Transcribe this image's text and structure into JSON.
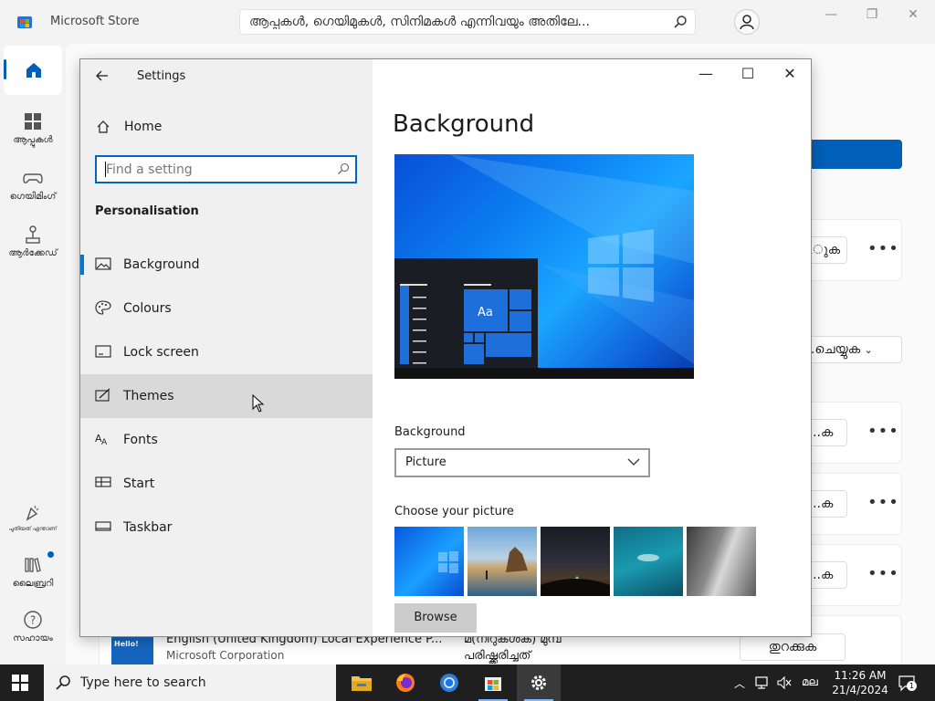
{
  "store": {
    "title": "Microsoft Store",
    "search_text": "ആപ്പുകൾ, ഗെയിമുകൾ, സിനിമകൾ എന്നിവയും അതിലേ...",
    "nav": [
      {
        "label": "ആപ്പുകൾ"
      },
      {
        "label": "ഗെയിമിംഗ്"
      },
      {
        "label": "ആർക്കേഡ്"
      },
      {
        "label": "പുതിയത് എന്താണ്"
      },
      {
        "label": "ലൈബ്രറി"
      },
      {
        "label": "സഹായം"
      }
    ],
    "rows": [
      {
        "button": "...ുക"
      },
      {
        "button": "...ചെയ്യുക"
      },
      {
        "button": "...ക"
      },
      {
        "button": "...ക"
      },
      {
        "button": "...ക"
      }
    ],
    "bottom_item": {
      "icon_text": "Hello!",
      "name": "English (United Kingdom) Local Experience P...",
      "publisher": "Microsoft Corporation",
      "status_line1": "മ(നിറുകൾക) മുമ്പ്",
      "status_line2": "പരിഷ്ക്കരിച്ചത്",
      "button": "തുറക്കുക"
    },
    "more_label": "•••"
  },
  "settings": {
    "title": "Settings",
    "home_label": "Home",
    "search_placeholder": "Find a setting",
    "section_title": "Personalisation",
    "nav": [
      {
        "label": "Background",
        "icon": "picture-icon"
      },
      {
        "label": "Colours",
        "icon": "palette-icon"
      },
      {
        "label": "Lock screen",
        "icon": "lock-screen-icon"
      },
      {
        "label": "Themes",
        "icon": "brush-icon"
      },
      {
        "label": "Fonts",
        "icon": "fonts-icon"
      },
      {
        "label": "Start",
        "icon": "start-icon"
      },
      {
        "label": "Taskbar",
        "icon": "taskbar-icon"
      }
    ],
    "selected": "Background",
    "hovered": "Themes",
    "page_heading": "Background",
    "preview_sample": "Aa",
    "background_label": "Background",
    "background_value": "Picture",
    "choose_label": "Choose your picture",
    "browse_label": "Browse"
  },
  "taskbar": {
    "search_placeholder": "Type here to search",
    "language": "മല",
    "time": "11:26 AM",
    "date": "21/4/2024",
    "notification_count": "1"
  },
  "colors": {
    "accent": "#0078d7",
    "store_accent": "#005fb8"
  }
}
